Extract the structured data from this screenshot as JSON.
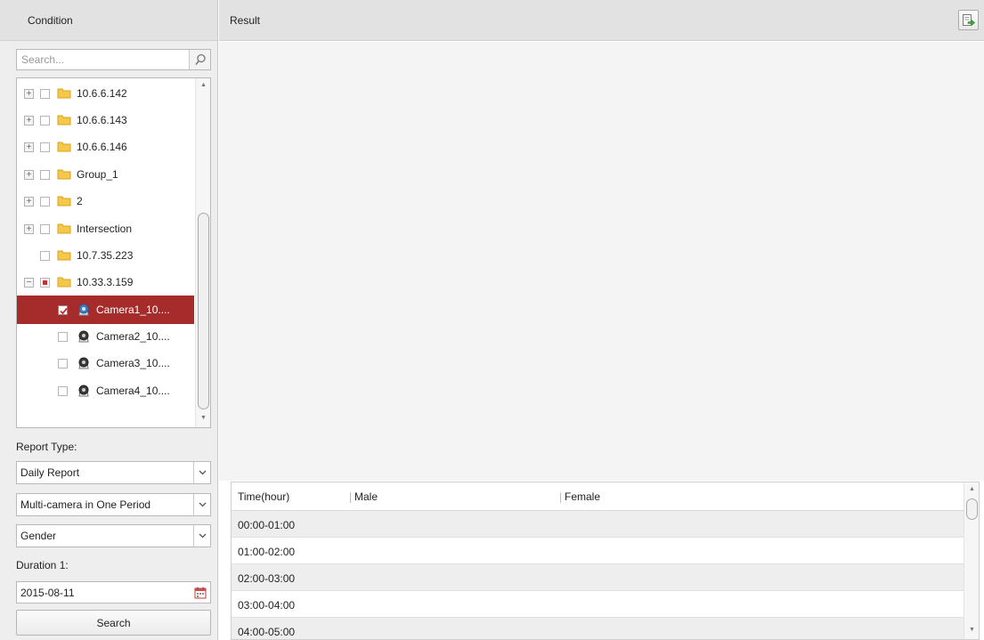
{
  "condition_panel": {
    "title": "Condition",
    "search_placeholder": "Search...",
    "tree": [
      {
        "label": "10.6.6.142",
        "type": "folder",
        "expander": "+",
        "checked": "none"
      },
      {
        "label": "10.6.6.143",
        "type": "folder",
        "expander": "+",
        "checked": "none"
      },
      {
        "label": "10.6.6.146",
        "type": "folder",
        "expander": "+",
        "checked": "none"
      },
      {
        "label": "Group_1",
        "type": "folder",
        "expander": "+",
        "checked": "none"
      },
      {
        "label": "2",
        "type": "folder",
        "expander": "+",
        "checked": "none"
      },
      {
        "label": "Intersection",
        "type": "folder",
        "expander": "+",
        "checked": "none"
      },
      {
        "label": "10.7.35.223",
        "type": "folder",
        "expander": "",
        "checked": "none"
      },
      {
        "label": "10.33.3.159",
        "type": "folder",
        "expander": "−",
        "checked": "partial"
      },
      {
        "label": "Camera1_10....",
        "type": "camera",
        "expander": "",
        "checked": "checked",
        "selected": true
      },
      {
        "label": "Camera2_10....",
        "type": "camera",
        "expander": "",
        "checked": "none"
      },
      {
        "label": "Camera3_10....",
        "type": "camera",
        "expander": "",
        "checked": "none"
      },
      {
        "label": "Camera4_10....",
        "type": "camera",
        "expander": "",
        "checked": "none"
      }
    ],
    "report_type_label": "Report Type:",
    "report_type_value": "Daily Report",
    "period_mode_value": "Multi-camera in One Period",
    "statistic_type_value": "Gender",
    "duration_label": "Duration 1:",
    "date_value": "2015-08-11",
    "search_button": "Search"
  },
  "result_panel": {
    "title": "Result",
    "export_icon": "export-icon",
    "table": {
      "columns": [
        "Time(hour)",
        "Male",
        "Female"
      ],
      "rows": [
        [
          "00:00-01:00",
          "",
          ""
        ],
        [
          "01:00-02:00",
          "",
          ""
        ],
        [
          "02:00-03:00",
          "",
          ""
        ],
        [
          "03:00-04:00",
          "",
          ""
        ],
        [
          "04:00-05:00",
          "",
          ""
        ]
      ]
    }
  },
  "colors": {
    "selected_row": "#a62c2c",
    "partial_check": "#c62f2f",
    "panel_bg": "#eeeeee",
    "header_bg": "#e2e2e2",
    "chart_bg": "#f4f4f4"
  }
}
